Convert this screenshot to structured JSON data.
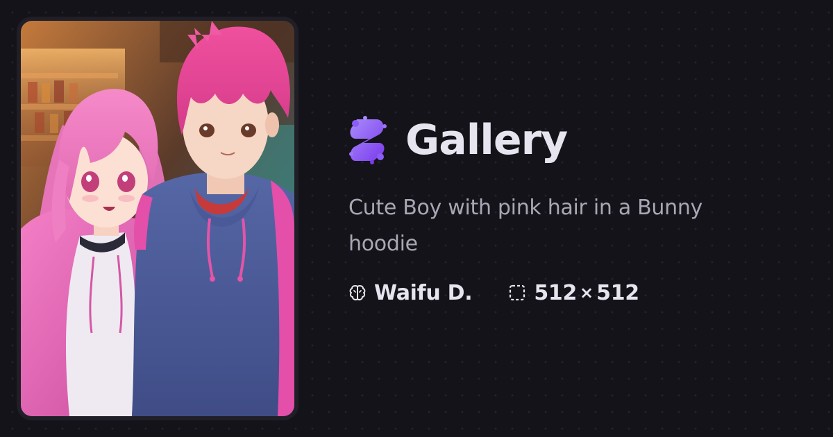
{
  "brand": {
    "logo_icon": "brand-logo-icon",
    "title": "Gallery",
    "accent": "#8b5cf6"
  },
  "image": {
    "caption": "Cute Boy with pink hair in a Bunny hoodie"
  },
  "meta": {
    "model": {
      "icon": "brain-icon",
      "label": "Waifu D."
    },
    "dimensions": {
      "icon": "dashed-frame-icon",
      "width": "512",
      "separator": "×",
      "height": "512"
    }
  },
  "colors": {
    "background": "#141319",
    "card": "#201f27",
    "title_text": "#e6e4ef",
    "caption_text": "#a9a7b4"
  }
}
